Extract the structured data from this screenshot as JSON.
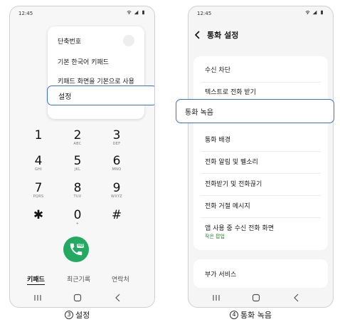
{
  "left": {
    "status_time": "12:45",
    "menu": {
      "items": [
        "단축번호",
        "기본 한국어 키패드",
        "키패드 화면을 기본으로 사용"
      ],
      "highlighted": "설정"
    },
    "keys": [
      {
        "num": "1",
        "sub": ""
      },
      {
        "num": "2",
        "sub": "ABC"
      },
      {
        "num": "3",
        "sub": "DEF"
      },
      {
        "num": "4",
        "sub": "GHI"
      },
      {
        "num": "5",
        "sub": "JKL"
      },
      {
        "num": "6",
        "sub": "MNO"
      },
      {
        "num": "7",
        "sub": "PQRS"
      },
      {
        "num": "8",
        "sub": "TUV"
      },
      {
        "num": "9",
        "sub": "WXYZ"
      },
      {
        "num": "✱",
        "sub": ""
      },
      {
        "num": "0",
        "sub": "+"
      },
      {
        "num": "#",
        "sub": ""
      }
    ],
    "call_label": "HD",
    "tabs": [
      "키패드",
      "최근기록",
      "연락처"
    ],
    "caption_num": "3",
    "caption_text": "설정"
  },
  "right": {
    "status_time": "12:45",
    "title": "통화 설정",
    "items": [
      {
        "label": "수신 차단"
      },
      {
        "label": "텍스트로 전화 받기"
      },
      {
        "label": "통화 녹음",
        "highlighted": true
      },
      {
        "label": "통화 배경"
      },
      {
        "label": "전화 알림 및 벨소리"
      },
      {
        "label": "전화받기 및 전화끊기"
      },
      {
        "label": "전화 거절 메시지"
      },
      {
        "label": "앱 사용 중 수신 전화 화면",
        "sub": "작은 팝업"
      },
      {
        "label": "부가 서비스"
      }
    ],
    "caption_num": "4",
    "caption_text": "통화 녹음"
  },
  "colors": {
    "highlight_border": "#3a6fd8",
    "call_green": "#23a962",
    "sub_green": "#2e7d32"
  }
}
